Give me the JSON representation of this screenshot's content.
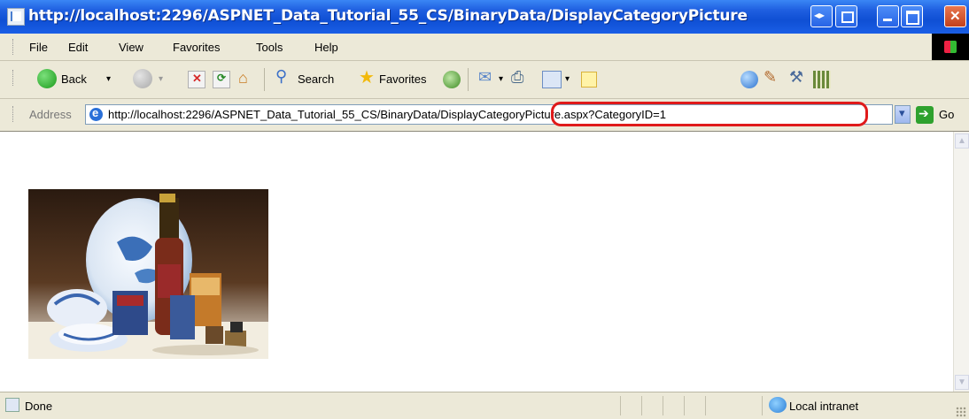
{
  "window": {
    "title": "http://localhost:2296/ASPNET_Data_Tutorial_55_CS/BinaryData/DisplayCategoryPicture"
  },
  "menu": {
    "items": [
      "File",
      "Edit",
      "View",
      "Favorites",
      "Tools",
      "Help"
    ]
  },
  "toolbar": {
    "back_label": "Back",
    "search_label": "Search",
    "favorites_label": "Favorites"
  },
  "address": {
    "label": "Address",
    "url_prefix": "http://localhost:2296/ASPNET_Data_Tutorial_55_CS/BinaryData/",
    "url_highlight": "DisplayCategoryPicture.aspx?CategoryID=1",
    "go_label": "Go"
  },
  "status": {
    "text": "Done",
    "zone": "Local intranet"
  }
}
